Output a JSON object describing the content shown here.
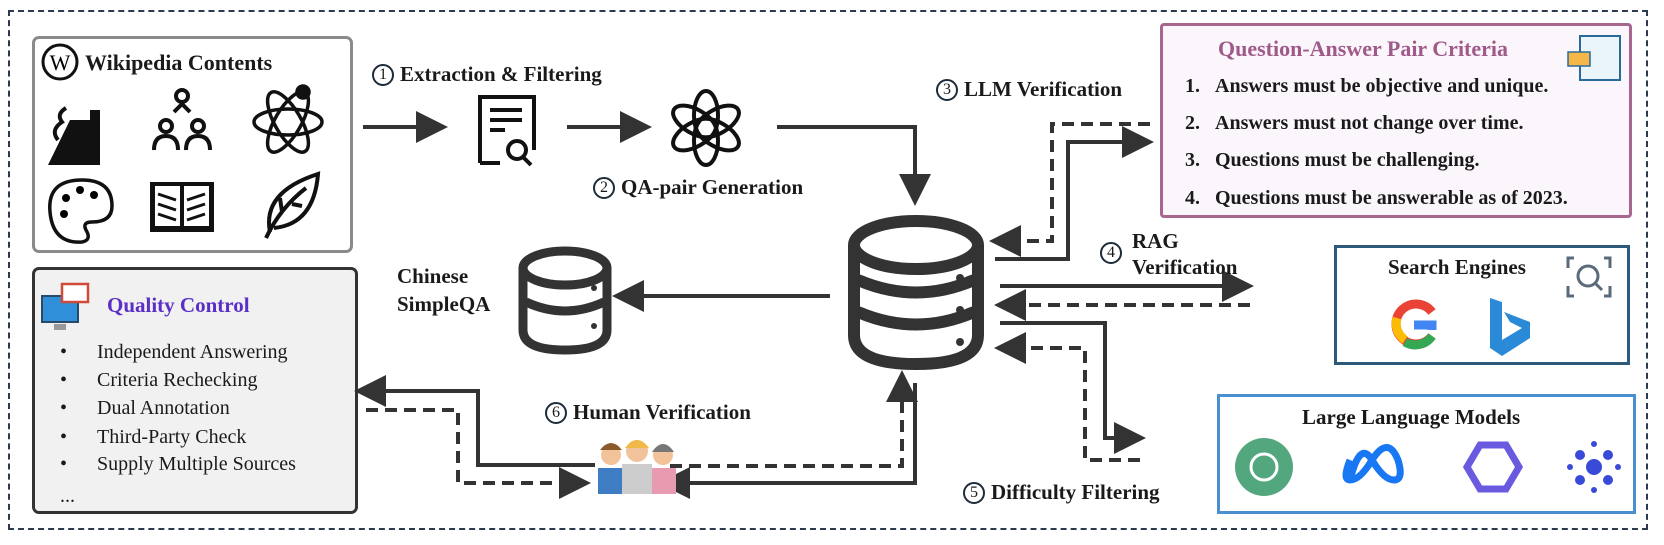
{
  "wikipedia": {
    "title": "Wikipedia Contents",
    "icons": [
      "great-wall-icon",
      "people-network-icon",
      "atom-icon",
      "palette-icon",
      "book-icon",
      "leaf-icon"
    ]
  },
  "steps": {
    "s1": {
      "num": "1",
      "label": "Extraction & Filtering"
    },
    "s2": {
      "num": "2",
      "label": "QA-pair Generation"
    },
    "s3": {
      "num": "3",
      "label": "LLM Verification"
    },
    "s4": {
      "num": "4",
      "label1": "RAG",
      "label2": "Verification"
    },
    "s5": {
      "num": "5",
      "label": "Difficulty Filtering"
    },
    "s6": {
      "num": "6",
      "label": "Human Verification"
    }
  },
  "output": {
    "line1": "Chinese",
    "line2": "SimpleQA"
  },
  "criteria": {
    "title": "Question-Answer Pair Criteria",
    "items": [
      {
        "n": "1.",
        "text": "Answers must be objective and unique."
      },
      {
        "n": "2.",
        "text": "Answers must not change over time."
      },
      {
        "n": "3.",
        "text": "Questions must be challenging."
      },
      {
        "n": "4.",
        "text": "Questions must be answerable as of 2023."
      }
    ]
  },
  "search": {
    "title": "Search Engines",
    "engines": [
      "google-icon",
      "bing-icon"
    ]
  },
  "llms": {
    "title": "Large Language Models",
    "models": [
      "chatgpt-icon",
      "meta-icon",
      "qwen-icon",
      "model-dots-icon"
    ]
  },
  "quality": {
    "title": "Quality Control",
    "items": [
      "Independent Answering",
      "Criteria Rechecking",
      "Dual Annotation",
      "Third-Party Check",
      "Supply Multiple Sources"
    ],
    "more": "..."
  },
  "colors": {
    "criteria_title": "#a05a8a",
    "quality_title": "#5a2fc8",
    "frame": "#2b3a4e",
    "arrow": "#333333"
  }
}
